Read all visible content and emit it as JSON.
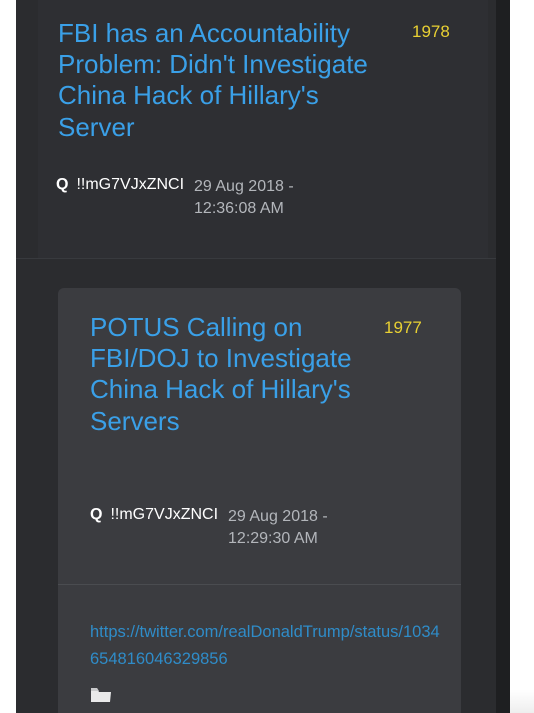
{
  "post_top": {
    "title": "FBI has an Accountability Problem: Didn't Investigate China Hack of Hillary's Server",
    "number": "1978",
    "author_label": "Q",
    "tripcode": "!!mG7VJxZNCI",
    "date": "29 Aug 2018 -",
    "time": "12:36:08 AM"
  },
  "post_quoted": {
    "title": "POTUS Calling on FBI/DOJ to Investigate China Hack of Hillary's Servers",
    "number": "1977",
    "author_label": "Q",
    "tripcode": "!!mG7VJxZNCI",
    "date": "29 Aug 2018 -",
    "time": "12:29:30 AM",
    "link": "https://twitter.com/realDonaldTrump/status/1034654816046329856",
    "attachment_icon": "folder-icon"
  },
  "colors": {
    "title": "#3aa0e8",
    "number": "#e8d033",
    "link": "#2f8cc8",
    "panel": "#2b2c2f",
    "card": "#3b3c40"
  }
}
